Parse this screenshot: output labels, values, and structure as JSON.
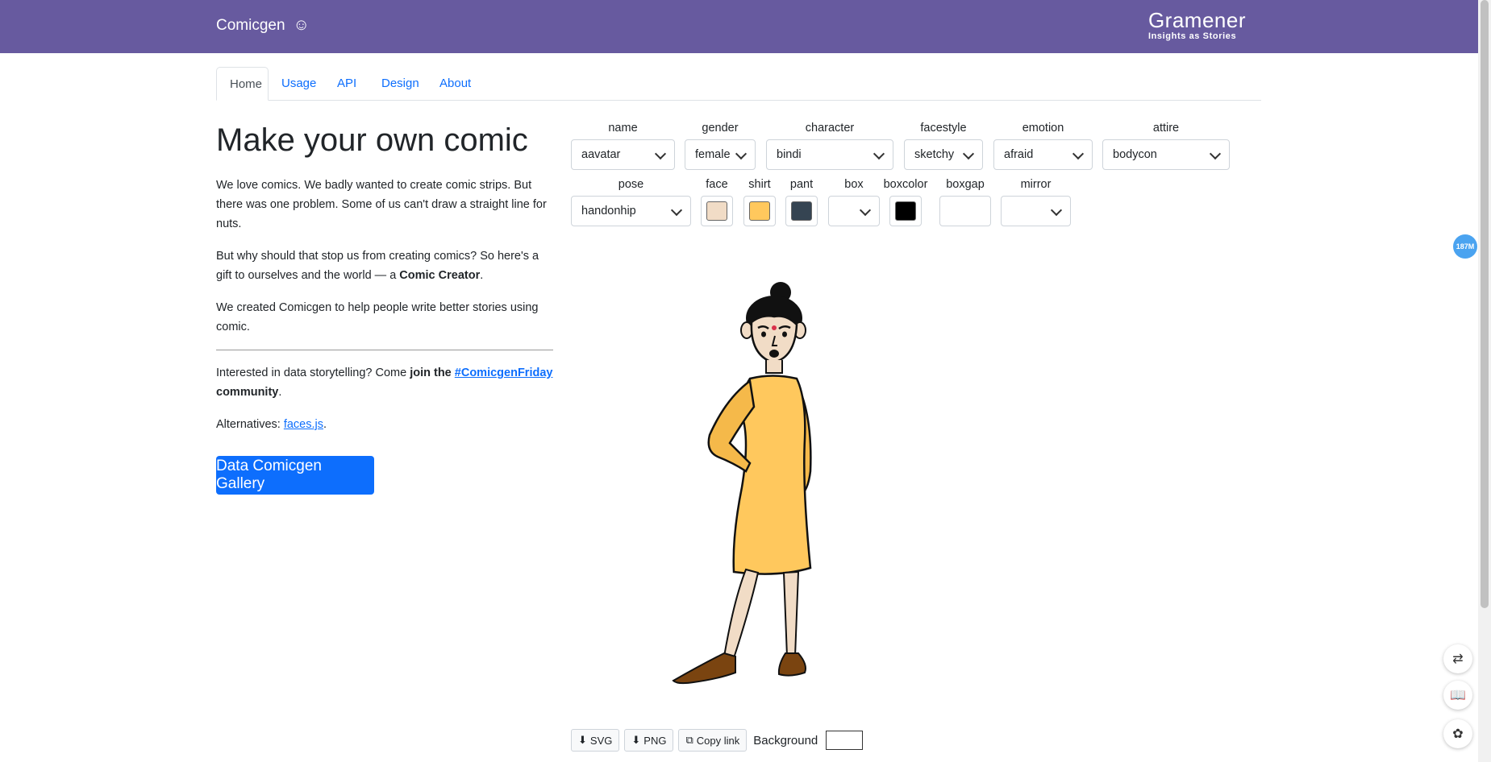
{
  "header": {
    "brand": "Comicgen",
    "smile_icon": "☺",
    "logo_main": "Gramener",
    "logo_tag": "Insights as Stories"
  },
  "tabs": [
    {
      "label": "Home",
      "active": true
    },
    {
      "label": "Usage"
    },
    {
      "label": "API"
    },
    {
      "label": "Design"
    },
    {
      "label": "About"
    }
  ],
  "intro": {
    "title": "Make your own comic",
    "p1": "We love comics. We badly wanted to create comic strips. But there was one problem. Some of us can't draw a straight line for nuts.",
    "p2_start": "But why should that stop us from creating comics? So here's a gift to ourselves and the world — a ",
    "p2_bold": "Comic Creator",
    "p2_end": ".",
    "p3": "We created Comicgen to help people write better stories using comic.",
    "p4_start": "Interested in data storytelling? Come ",
    "p4_bold1": "join the ",
    "p4_link": "#ComicgenFriday",
    "p4_bold2": "community",
    "p4_end": ".",
    "p5_start": "Alternatives: ",
    "p5_link": "faces.js",
    "p5_end": ".",
    "gallery_button": "Data Comicgen Gallery"
  },
  "controls": {
    "name": {
      "label": "name",
      "value": "aavatar"
    },
    "gender": {
      "label": "gender",
      "value": "female"
    },
    "character": {
      "label": "character",
      "value": "bindi"
    },
    "facestyle": {
      "label": "facestyle",
      "value": "sketchy"
    },
    "emotion": {
      "label": "emotion",
      "value": "afraid"
    },
    "attire": {
      "label": "attire",
      "value": "bodycon"
    },
    "pose": {
      "label": "pose",
      "value": "handonhip"
    },
    "face": {
      "label": "face",
      "color": "#f1dcc6"
    },
    "shirt": {
      "label": "shirt",
      "color": "#ffc85d"
    },
    "pant": {
      "label": "pant",
      "color": "#354452"
    },
    "box": {
      "label": "box",
      "value": ""
    },
    "boxcolor": {
      "label": "boxcolor",
      "color": "#000000"
    },
    "boxgap": {
      "label": "boxgap",
      "value": ""
    },
    "mirror": {
      "label": "mirror",
      "value": ""
    }
  },
  "bottom_bar": {
    "svg_label": "SVG",
    "png_label": "PNG",
    "copy_label": "Copy link",
    "background_label": "Background"
  },
  "floating": {
    "badge_text": "187M"
  },
  "colors": {
    "topbar": "#675a9f",
    "link": "#0d6efd",
    "button": "#0d6efd"
  }
}
